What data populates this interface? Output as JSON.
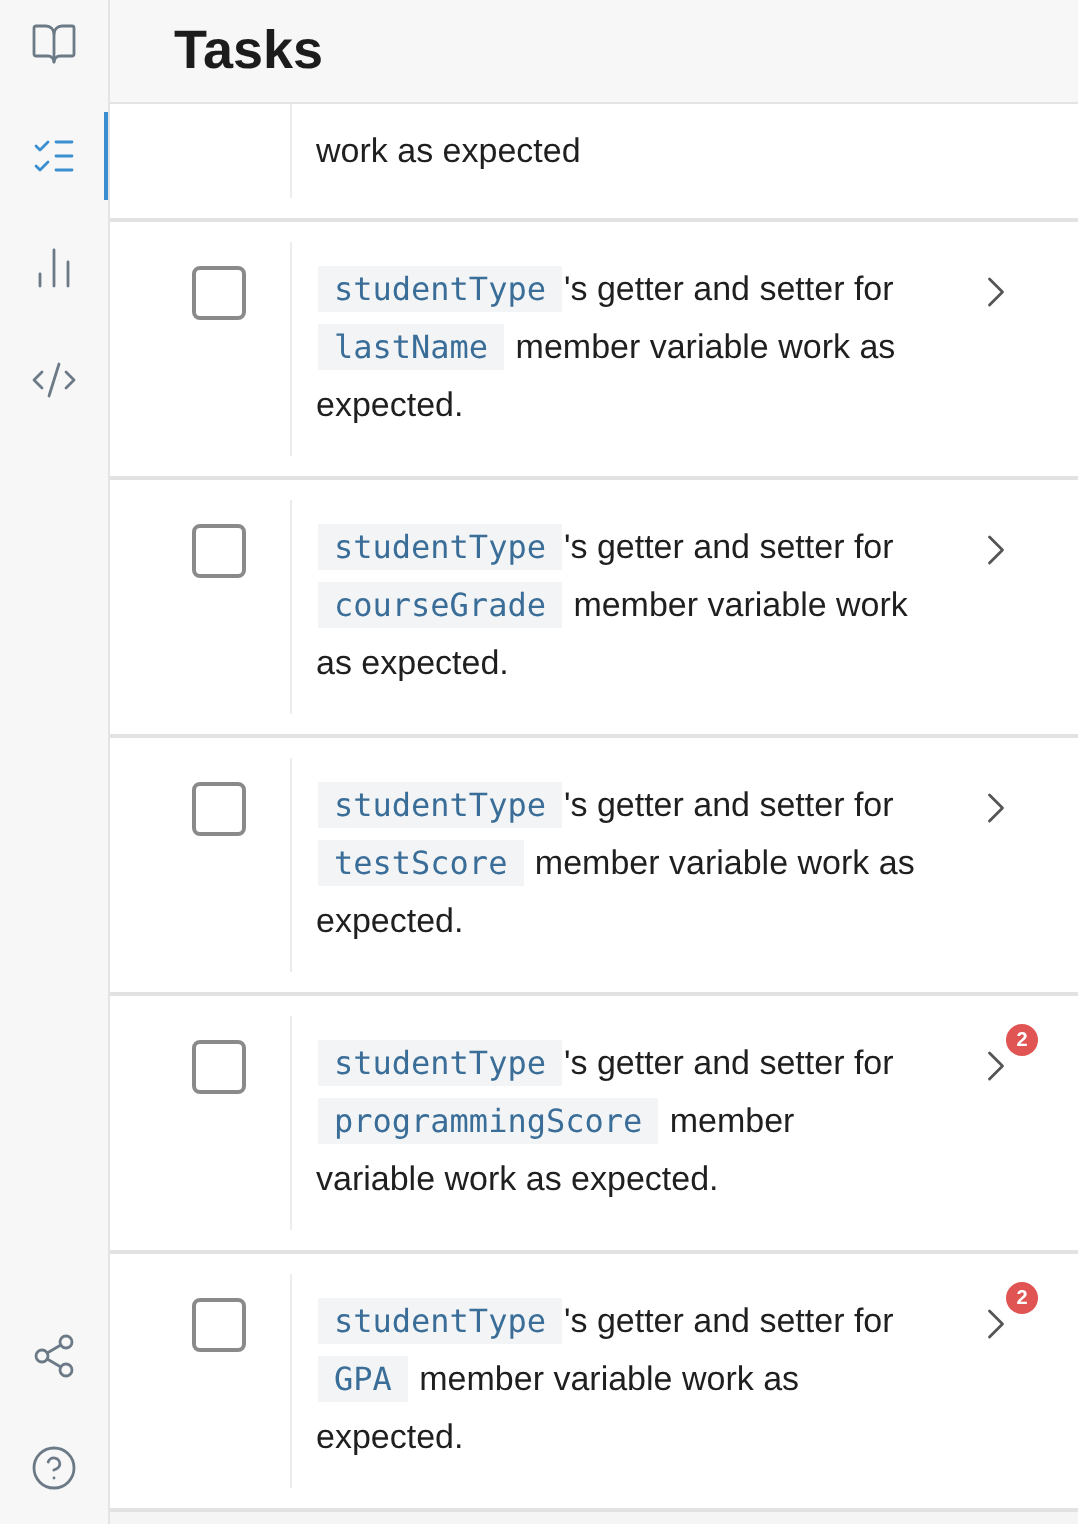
{
  "sidebar": {
    "items": [
      {
        "kind": "book",
        "selected": false
      },
      {
        "kind": "tasks",
        "selected": true
      },
      {
        "kind": "chart",
        "selected": false
      },
      {
        "kind": "code",
        "selected": false
      }
    ],
    "bottom_items": [
      {
        "kind": "share"
      },
      {
        "kind": "help"
      }
    ]
  },
  "header": {
    "title": "Tasks"
  },
  "tasks": [
    {
      "kind": "partial",
      "segments": [
        {
          "kind": "text",
          "text": "work as expected"
        }
      ]
    },
    {
      "kind": "full",
      "checked": false,
      "segments": [
        {
          "kind": "code",
          "text": "studentType"
        },
        {
          "kind": "text",
          "text": "'s getter and setter for "
        },
        {
          "kind": "code",
          "text": "lastName"
        },
        {
          "kind": "text",
          "text": " member variable work as expected."
        }
      ]
    },
    {
      "kind": "full",
      "checked": false,
      "segments": [
        {
          "kind": "code",
          "text": "studentType"
        },
        {
          "kind": "text",
          "text": "'s getter and setter for "
        },
        {
          "kind": "code",
          "text": "courseGrade"
        },
        {
          "kind": "text",
          "text": " member variable work as expected."
        }
      ]
    },
    {
      "kind": "full",
      "checked": false,
      "segments": [
        {
          "kind": "code",
          "text": "studentType"
        },
        {
          "kind": "text",
          "text": "'s getter and setter for "
        },
        {
          "kind": "code",
          "text": "testScore"
        },
        {
          "kind": "text",
          "text": " member variable work as expected."
        }
      ]
    },
    {
      "kind": "full",
      "checked": false,
      "badge": "2",
      "segments": [
        {
          "kind": "code",
          "text": "studentType"
        },
        {
          "kind": "text",
          "text": "'s getter and setter for "
        },
        {
          "kind": "code",
          "text": "programmingScore"
        },
        {
          "kind": "text",
          "text": " member variable work as expected."
        }
      ]
    },
    {
      "kind": "full",
      "checked": false,
      "badge": "2",
      "segments": [
        {
          "kind": "code",
          "text": "studentType"
        },
        {
          "kind": "text",
          "text": "'s getter and setter for "
        },
        {
          "kind": "code",
          "text": "GPA"
        },
        {
          "kind": "text",
          "text": " member variable work as expected."
        }
      ]
    }
  ]
}
